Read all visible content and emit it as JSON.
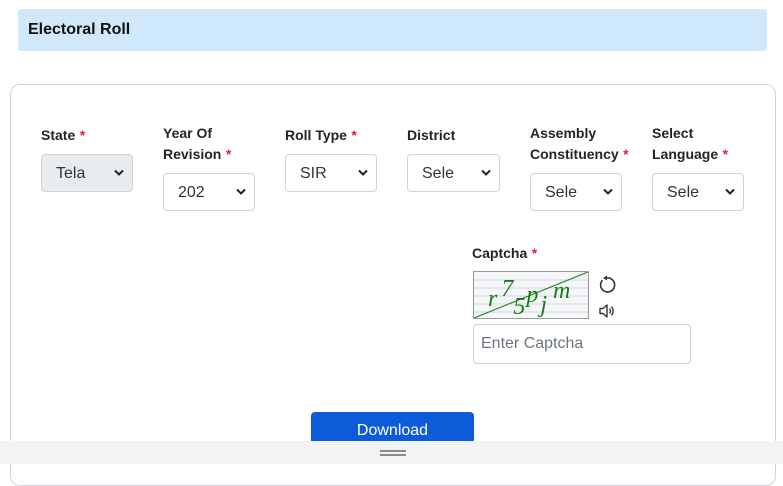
{
  "header": {
    "title": "Electoral Roll"
  },
  "form": {
    "state": {
      "label": "State",
      "required": "*",
      "value": "Tela"
    },
    "year": {
      "label_line1": "Year Of",
      "label_line2": "Revision",
      "required": "*",
      "value": "202"
    },
    "roll_type": {
      "label": "Roll Type",
      "required": "*",
      "value": "SIR"
    },
    "district": {
      "label": "District",
      "value": "Sele"
    },
    "assembly": {
      "label_line1": "Assembly",
      "label_line2": "Constituency",
      "required": "*",
      "value": "Sele"
    },
    "language": {
      "label_line1": "Select",
      "label_line2": "Language",
      "required": "*",
      "value": "Sele"
    },
    "captcha": {
      "label": "Captcha",
      "required": "*",
      "image_text": "r75pjm",
      "input_placeholder": "Enter Captcha",
      "refresh_icon": "refresh-icon",
      "audio_icon": "speaker-icon"
    },
    "download_label": "Download"
  },
  "colors": {
    "banner": "#cfe8fb",
    "required": "#d9233a",
    "button": "#0d5bd9",
    "captcha_text": "#1a7a1a"
  }
}
